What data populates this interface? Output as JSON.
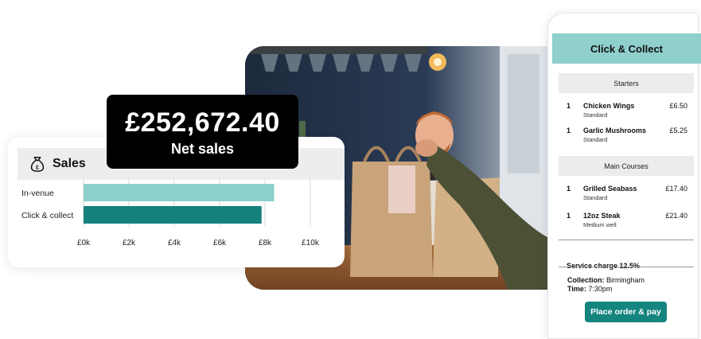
{
  "net_sales": {
    "amount": "£252,672.40",
    "label": "Net sales"
  },
  "sales_card": {
    "title": "Sales",
    "icon": "money-bag-icon"
  },
  "chart_data": {
    "type": "bar",
    "orientation": "horizontal",
    "categories": [
      "In-venue",
      "Click & collect"
    ],
    "values": [
      8400,
      7850
    ],
    "colors": [
      "#8ccfcc",
      "#15807c"
    ],
    "xticks": [
      "£0k",
      "£2k",
      "£4k",
      "£6k",
      "£8k",
      "£10k"
    ],
    "xlim": [
      0,
      10000
    ],
    "grid": true
  },
  "phone": {
    "title": "Click & Collect",
    "sections": [
      {
        "label": "Starters",
        "items": [
          {
            "qty": "1",
            "name": "Chicken Wings",
            "option": "Standard",
            "price": "£6.50"
          },
          {
            "qty": "1",
            "name": "Garlic Mushrooms",
            "option": "Standard",
            "price": "£5.25"
          }
        ]
      },
      {
        "label": "Main Courses",
        "items": [
          {
            "qty": "1",
            "name": "Grilled Seabass",
            "option": "Standard",
            "price": "£17.40"
          },
          {
            "qty": "1",
            "name": "12oz Steak",
            "option": "Medium well",
            "price": "£21.40"
          }
        ]
      }
    ],
    "service_charge": "Service charge 12.5%",
    "collection_label": "Collection:",
    "collection_value": "Birmingham",
    "time_label": "Time:",
    "time_value": "7:30pm",
    "cta_label": "Place order & pay"
  },
  "colors": {
    "teal_light": "#8fcfcc",
    "teal_dark": "#15857f",
    "badge_bg": "#000000"
  }
}
